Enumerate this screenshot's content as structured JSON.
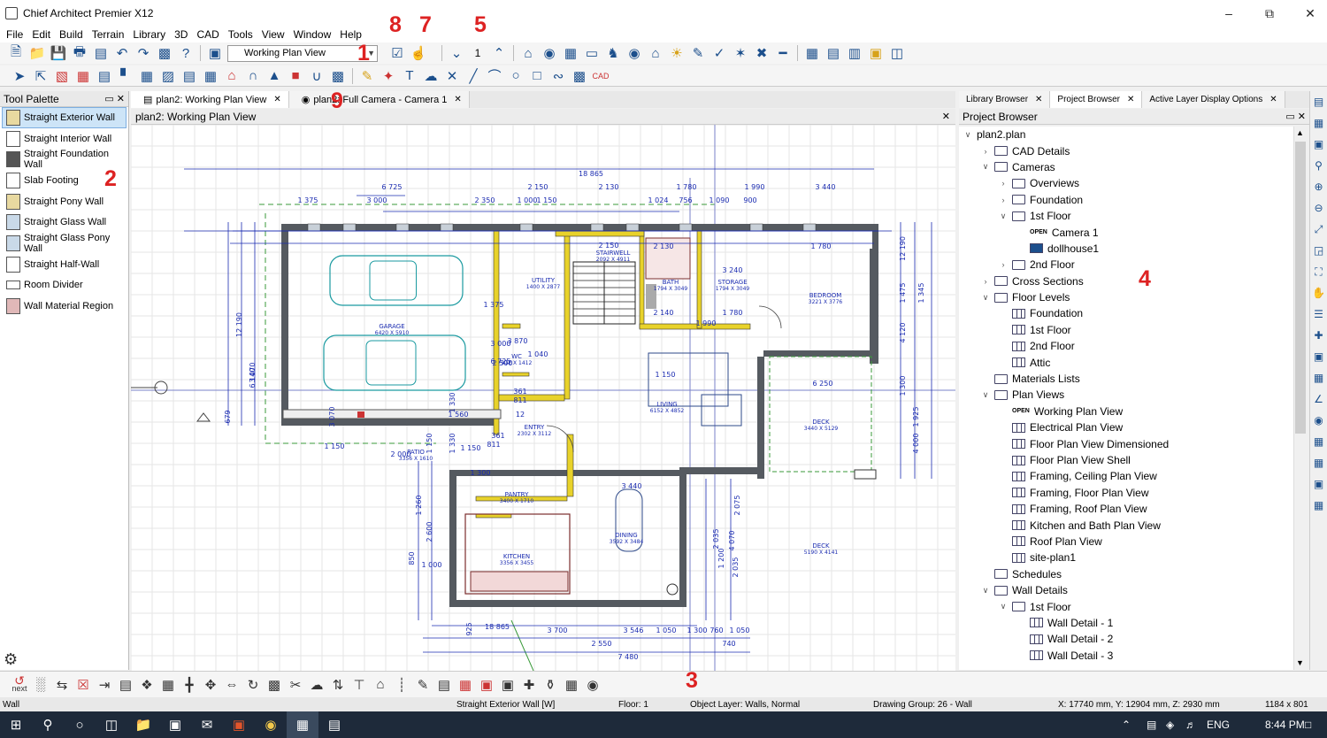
{
  "window": {
    "title": "Chief Architect Premier X12"
  },
  "menu": [
    "File",
    "Edit",
    "Build",
    "Terrain",
    "Library",
    "3D",
    "CAD",
    "Tools",
    "View",
    "Window",
    "Help"
  ],
  "toolbar": {
    "view_select": "Working Plan View",
    "floor_number": "1"
  },
  "callouts": [
    "1",
    "2",
    "3",
    "4",
    "5",
    "7",
    "8",
    "9"
  ],
  "tool_palette": {
    "title": "Tool Palette",
    "items": [
      "Straight Exterior Wall",
      "Straight Interior Wall",
      "Straight Foundation Wall",
      "Slab Footing",
      "Straight Pony Wall",
      "Straight Glass Wall",
      "Straight Glass Pony Wall",
      "Straight Half-Wall",
      "Room Divider",
      "Wall Material Region"
    ]
  },
  "doc_tabs": [
    "plan2:  Working Plan View",
    "plan2: Full Camera - Camera 1"
  ],
  "view_header": "plan2:  Working Plan View",
  "plan": {
    "dimensions": [
      "18 865",
      "6 725",
      "2 150",
      "2 130",
      "1 780",
      "1 990",
      "3 440",
      "1 375",
      "3 000",
      "2 350",
      "1 000",
      "1 150",
      "1 024",
      "756",
      "1 090",
      "900",
      "2 150",
      "2 130",
      "1 780",
      "3 240",
      "2 140",
      "1 780",
      "1 990",
      "3 870",
      "1 040",
      "1 150",
      "6 250",
      "3 440",
      "3 700",
      "3 546",
      "1 050",
      "1 300",
      "760",
      "1 050",
      "740",
      "2 550",
      "7 480",
      "18 865",
      "925",
      "679",
      "12 190",
      "6 140",
      "3 070",
      "3 070",
      "12 190",
      "1 475",
      "1 345",
      "4 120",
      "1 300",
      "1 925",
      "4 000",
      "2 075",
      "4 070",
      "2 035",
      "2 035",
      "1 200",
      "1 260",
      "2 600",
      "850",
      "1 150",
      "1 330",
      "1 330",
      "811",
      "361",
      "361",
      "811",
      "1 150",
      "1 300",
      "1 375",
      "3 000",
      "6 725",
      "2 500",
      "2 000",
      "1 150",
      "1 000",
      "1 560",
      "12"
    ],
    "rooms": [
      {
        "name": "GARAGE",
        "size": "6420 X 5910"
      },
      {
        "name": "STAIRWELL",
        "size": "2092 X 4911"
      },
      {
        "name": "BATH",
        "size": "1794 X 3049"
      },
      {
        "name": "STORAGE",
        "size": "1794 X 3049"
      },
      {
        "name": "BEDROOM",
        "size": "3221 X 3776"
      },
      {
        "name": "UTILITY",
        "size": "1400 X 2877"
      },
      {
        "name": "WC",
        "size": "912 X 1412"
      },
      {
        "name": "LIVING",
        "size": "6152 X 4852"
      },
      {
        "name": "DECK",
        "size": "3440 X 5129"
      },
      {
        "name": "ENTRY",
        "size": "2302 X 3112"
      },
      {
        "name": "PATIO",
        "size": "3356 X 1610"
      },
      {
        "name": "PANTRY",
        "size": "3400 X 1710"
      },
      {
        "name": "DINING",
        "size": "3592 X 3484"
      },
      {
        "name": "KITCHEN",
        "size": "3356 X 3455"
      },
      {
        "name": "DECK",
        "size": "5190 X 4141"
      }
    ]
  },
  "right_tabs": [
    "Library Browser",
    "Project Browser",
    "Active Layer Display Options"
  ],
  "project_browser": {
    "title": "Project Browser",
    "tree": [
      {
        "level": 0,
        "arrow": "down",
        "icon": "none",
        "label": "plan2.plan"
      },
      {
        "level": 1,
        "arrow": "right",
        "icon": "folder",
        "label": "CAD Details"
      },
      {
        "level": 1,
        "arrow": "down",
        "icon": "folder",
        "label": "Cameras"
      },
      {
        "level": 2,
        "arrow": "right",
        "icon": "folder",
        "label": "Overviews"
      },
      {
        "level": 2,
        "arrow": "right",
        "icon": "folder",
        "label": "Foundation"
      },
      {
        "level": 2,
        "arrow": "down",
        "icon": "folder",
        "label": "1st Floor"
      },
      {
        "level": 3,
        "arrow": "none",
        "icon": "open",
        "label": "Camera 1"
      },
      {
        "level": 3,
        "arrow": "none",
        "icon": "camera",
        "label": "dollhouse1"
      },
      {
        "level": 2,
        "arrow": "right",
        "icon": "folder",
        "label": "2nd Floor"
      },
      {
        "level": 1,
        "arrow": "right",
        "icon": "folder",
        "label": "Cross Sections"
      },
      {
        "level": 1,
        "arrow": "down",
        "icon": "folder",
        "label": "Floor Levels"
      },
      {
        "level": 2,
        "arrow": "none",
        "icon": "plan",
        "label": "Foundation"
      },
      {
        "level": 2,
        "arrow": "none",
        "icon": "plan",
        "label": "1st Floor"
      },
      {
        "level": 2,
        "arrow": "none",
        "icon": "plan",
        "label": "2nd Floor"
      },
      {
        "level": 2,
        "arrow": "none",
        "icon": "plan",
        "label": "Attic"
      },
      {
        "level": 1,
        "arrow": "none",
        "icon": "folder",
        "label": "Materials Lists"
      },
      {
        "level": 1,
        "arrow": "down",
        "icon": "folder",
        "label": "Plan Views"
      },
      {
        "level": 2,
        "arrow": "none",
        "icon": "open",
        "label": "Working Plan View"
      },
      {
        "level": 2,
        "arrow": "none",
        "icon": "plan",
        "label": "Electrical Plan View"
      },
      {
        "level": 2,
        "arrow": "none",
        "icon": "plan",
        "label": "Floor Plan View Dimensioned"
      },
      {
        "level": 2,
        "arrow": "none",
        "icon": "plan",
        "label": "Floor Plan View Shell"
      },
      {
        "level": 2,
        "arrow": "none",
        "icon": "plan",
        "label": "Framing, Ceiling Plan View"
      },
      {
        "level": 2,
        "arrow": "none",
        "icon": "plan",
        "label": "Framing, Floor Plan View"
      },
      {
        "level": 2,
        "arrow": "none",
        "icon": "plan",
        "label": "Framing, Roof Plan View"
      },
      {
        "level": 2,
        "arrow": "none",
        "icon": "plan",
        "label": "Kitchen and Bath Plan View"
      },
      {
        "level": 2,
        "arrow": "none",
        "icon": "plan",
        "label": "Roof Plan View"
      },
      {
        "level": 2,
        "arrow": "none",
        "icon": "plan",
        "label": "site-plan1"
      },
      {
        "level": 1,
        "arrow": "none",
        "icon": "folder",
        "label": "Schedules"
      },
      {
        "level": 1,
        "arrow": "down",
        "icon": "folder",
        "label": "Wall Details"
      },
      {
        "level": 2,
        "arrow": "down",
        "icon": "folder",
        "label": "1st Floor"
      },
      {
        "level": 3,
        "arrow": "none",
        "icon": "plan",
        "label": "Wall Detail - 1"
      },
      {
        "level": 3,
        "arrow": "none",
        "icon": "plan",
        "label": "Wall Detail - 2"
      },
      {
        "level": 3,
        "arrow": "none",
        "icon": "plan",
        "label": "Wall Detail - 3"
      }
    ]
  },
  "bottom_toolbar": {
    "next_label": "next"
  },
  "status": {
    "left": "Wall",
    "tool": "Straight Exterior Wall [W]",
    "floor": "Floor: 1",
    "layer": "Object Layer: Walls,  Normal",
    "group": "Drawing Group: 26 - Wall",
    "coords": "X: 17740 mm, Y: 12904 mm, Z: 2930 mm",
    "size": "1184 x 801"
  },
  "taskbar": {
    "language": "ENG",
    "time": "8:44 PM"
  },
  "colors": {
    "wall_yellow": "#e8d22a",
    "wall_gray": "#555a60",
    "dimension_blue": "#1a2bb0",
    "grid": "#e6e6e6",
    "callout_red": "#d22222"
  }
}
